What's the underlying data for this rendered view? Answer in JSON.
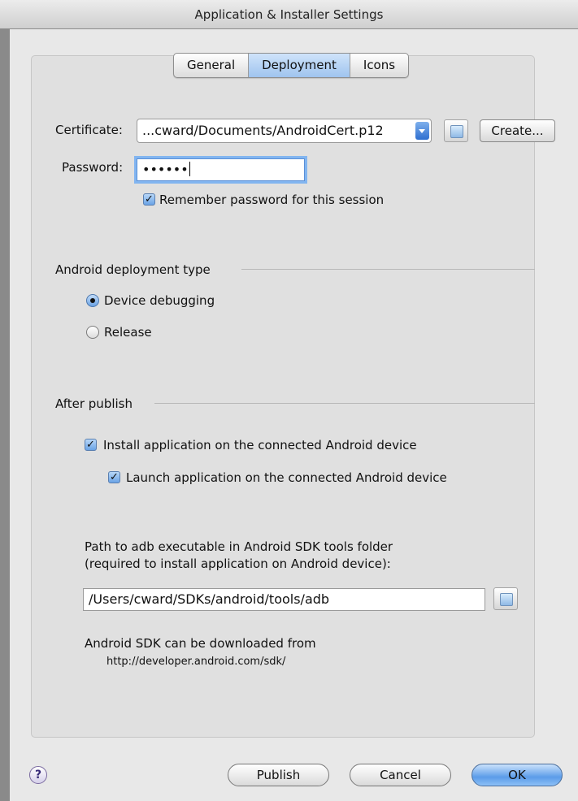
{
  "window": {
    "title": "Application & Installer Settings"
  },
  "tabs": [
    {
      "label": "General"
    },
    {
      "label": "Deployment"
    },
    {
      "label": "Icons"
    }
  ],
  "certificate": {
    "label": "Certificate:",
    "value": "...cward/Documents/AndroidCert.p12",
    "create_label": "Create..."
  },
  "password": {
    "label": "Password:",
    "value": "••••••",
    "remember_label": "Remember password for this session",
    "remember_checked": true
  },
  "deployment_type": {
    "heading": "Android deployment type",
    "options": [
      {
        "label": "Device debugging",
        "selected": true
      },
      {
        "label": "Release",
        "selected": false
      }
    ]
  },
  "after_publish": {
    "heading": "After publish",
    "install_label": "Install application on the connected Android device",
    "install_checked": true,
    "launch_label": "Launch application on the connected Android device",
    "launch_checked": true
  },
  "adb": {
    "label_line1": "Path to adb executable in Android SDK tools folder",
    "label_line2": "(required to install application on Android device):",
    "path": "/Users/cward/SDKs/android/tools/adb"
  },
  "sdk_info": {
    "line1": "Android SDK can be downloaded from",
    "url": "http://developer.android.com/sdk/"
  },
  "footer": {
    "help_label": "?",
    "publish_label": "Publish",
    "cancel_label": "Cancel",
    "ok_label": "OK"
  },
  "icons": [
    "folder-icon",
    "popup-arrow-icon",
    "checkmark-icon",
    "help-icon"
  ],
  "colors": {
    "accent": "#5b9ce9",
    "focus_ring": "#82b5f0"
  }
}
